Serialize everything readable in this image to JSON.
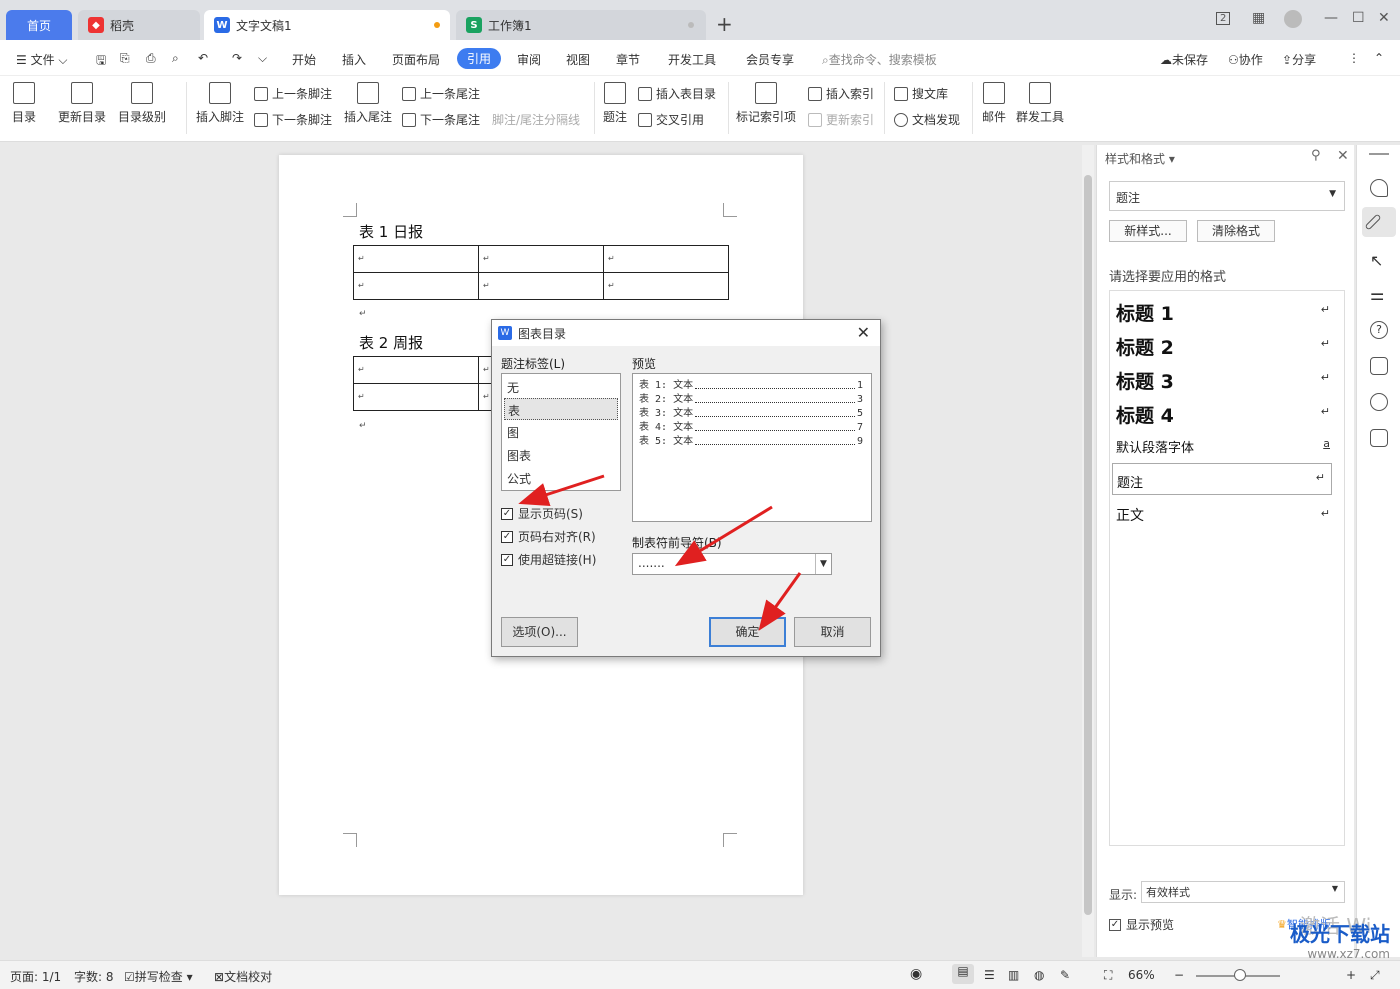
{
  "tabs": {
    "home": "首页",
    "daoke": "稻壳",
    "doc": "文字文稿1",
    "workbook": "工作簿1"
  },
  "window": {
    "badge": "2"
  },
  "menu": {
    "file": "文件",
    "items": [
      "开始",
      "插入",
      "页面布局",
      "引用",
      "审阅",
      "视图",
      "章节",
      "开发工具",
      "会员专享"
    ],
    "active": "引用",
    "search_placeholder": "查找命令、搜索模板",
    "unsaved": "未保存",
    "collab": "协作",
    "share": "分享"
  },
  "ribbon": {
    "toc": "目录",
    "update_toc": "更新目录",
    "toc_level": "目录级别",
    "insert_footnote": "插入脚注",
    "prev_footnote": "上一条脚注",
    "next_footnote": "下一条脚注",
    "insert_endnote": "插入尾注",
    "prev_endnote": "上一条尾注",
    "next_endnote": "下一条尾注",
    "separator": "脚注/尾注分隔线",
    "caption": "题注",
    "insert_table_toc": "插入表目录",
    "cross_ref": "交叉引用",
    "mark_index": "标记索引项",
    "insert_index": "插入索引",
    "update_index": "更新索引",
    "search_lib": "搜文库",
    "doc_discover": "文档发现",
    "mail": "邮件",
    "mass_tool": "群发工具"
  },
  "document": {
    "caption1": "表 1 日报",
    "caption2": "表 2 周报",
    "mark": "↵"
  },
  "dialog": {
    "title": "图表目录",
    "label_list_title": "题注标签(L)",
    "labels": [
      "无",
      "表",
      "图",
      "图表",
      "公式"
    ],
    "selected_label": "表",
    "preview_title": "预览",
    "preview": [
      {
        "text": "表 1: 文本",
        "page": "1"
      },
      {
        "text": "表 2: 文本",
        "page": "3"
      },
      {
        "text": "表 3: 文本",
        "page": "5"
      },
      {
        "text": "表 4: 文本",
        "page": "7"
      },
      {
        "text": "表 5: 文本",
        "page": "9"
      }
    ],
    "show_page": "显示页码(S)",
    "align_right": "页码右对齐(R)",
    "hyperlink": "使用超链接(H)",
    "tab_leader_label": "制表符前导符(B)",
    "tab_leader_value": ".......",
    "options": "选项(O)...",
    "ok": "确定",
    "cancel": "取消"
  },
  "panel": {
    "title": "样式和格式",
    "current": "题注",
    "new_style": "新样式...",
    "clear": "清除格式",
    "choose": "请选择要应用的格式",
    "styles": [
      "标题 1",
      "标题 2",
      "标题 3",
      "标题 4",
      "默认段落字体",
      "题注",
      "正文"
    ],
    "show_label": "显示:",
    "show_value": "有效样式",
    "show_preview": "显示预览",
    "smart": "智能排版"
  },
  "status": {
    "page": "页面: 1/1",
    "words": "字数: 8",
    "spell": "拼写检查",
    "proof": "文档校对",
    "zoom": "66%"
  },
  "watermark": {
    "activate": "激活 Wi",
    "site": "极光下载站",
    "url": "www.xz7.com"
  }
}
